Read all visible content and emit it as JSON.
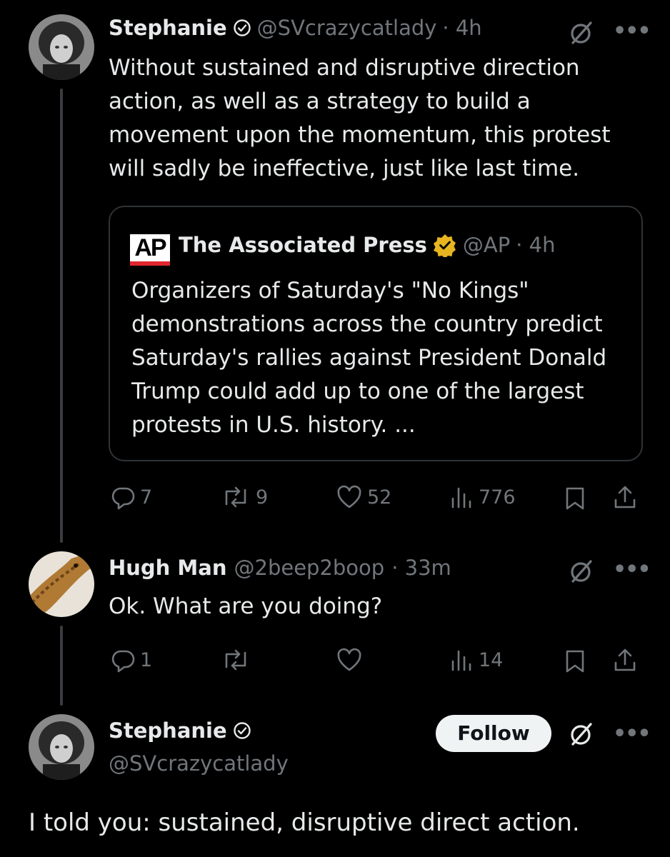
{
  "tweet1": {
    "name": "Stephanie",
    "handle": "@SVcrazycatlady",
    "time": "· 4h",
    "text_lines": [
      "Without sustained and disruptive direction",
      "action, as well as a strategy to build a",
      "movement upon the momentum, this protest",
      "will sadly be ineffective, just like last time."
    ],
    "quote": {
      "logo_text": "AP",
      "name": "The Associated Press",
      "handle": "@AP",
      "time": "· 4h",
      "text_lines": [
        "Organizers of Saturday's \"No Kings\"",
        "demonstrations across the country predict",
        "Saturday's rallies against President Donald",
        "Trump could add up to one of the largest",
        "protests in U.S. history. ..."
      ]
    },
    "stats": {
      "replies": "7",
      "reposts": "9",
      "likes": "52",
      "views": "776"
    }
  },
  "tweet2": {
    "name": "Hugh Man",
    "handle": "@2beep2boop",
    "time": "· 33m",
    "text": "Ok. What are you doing?",
    "stats": {
      "replies": "1",
      "reposts": "",
      "likes": "",
      "views": "14"
    }
  },
  "tweet3": {
    "name": "Stephanie",
    "handle": "@SVcrazycatlady",
    "follow_label": "Follow",
    "text": "I told you: sustained, disruptive direct action."
  },
  "colors": {
    "background": "#000000",
    "text": "#e7e9ea",
    "muted": "#71767b",
    "ap_red": "#e0262e",
    "gold_badge": "#e8b520"
  },
  "icons": [
    "verified-icon",
    "gold-verified-icon",
    "grok-icon",
    "more-icon",
    "reply-icon",
    "repost-icon",
    "like-icon",
    "views-icon",
    "bookmark-icon",
    "share-icon"
  ]
}
